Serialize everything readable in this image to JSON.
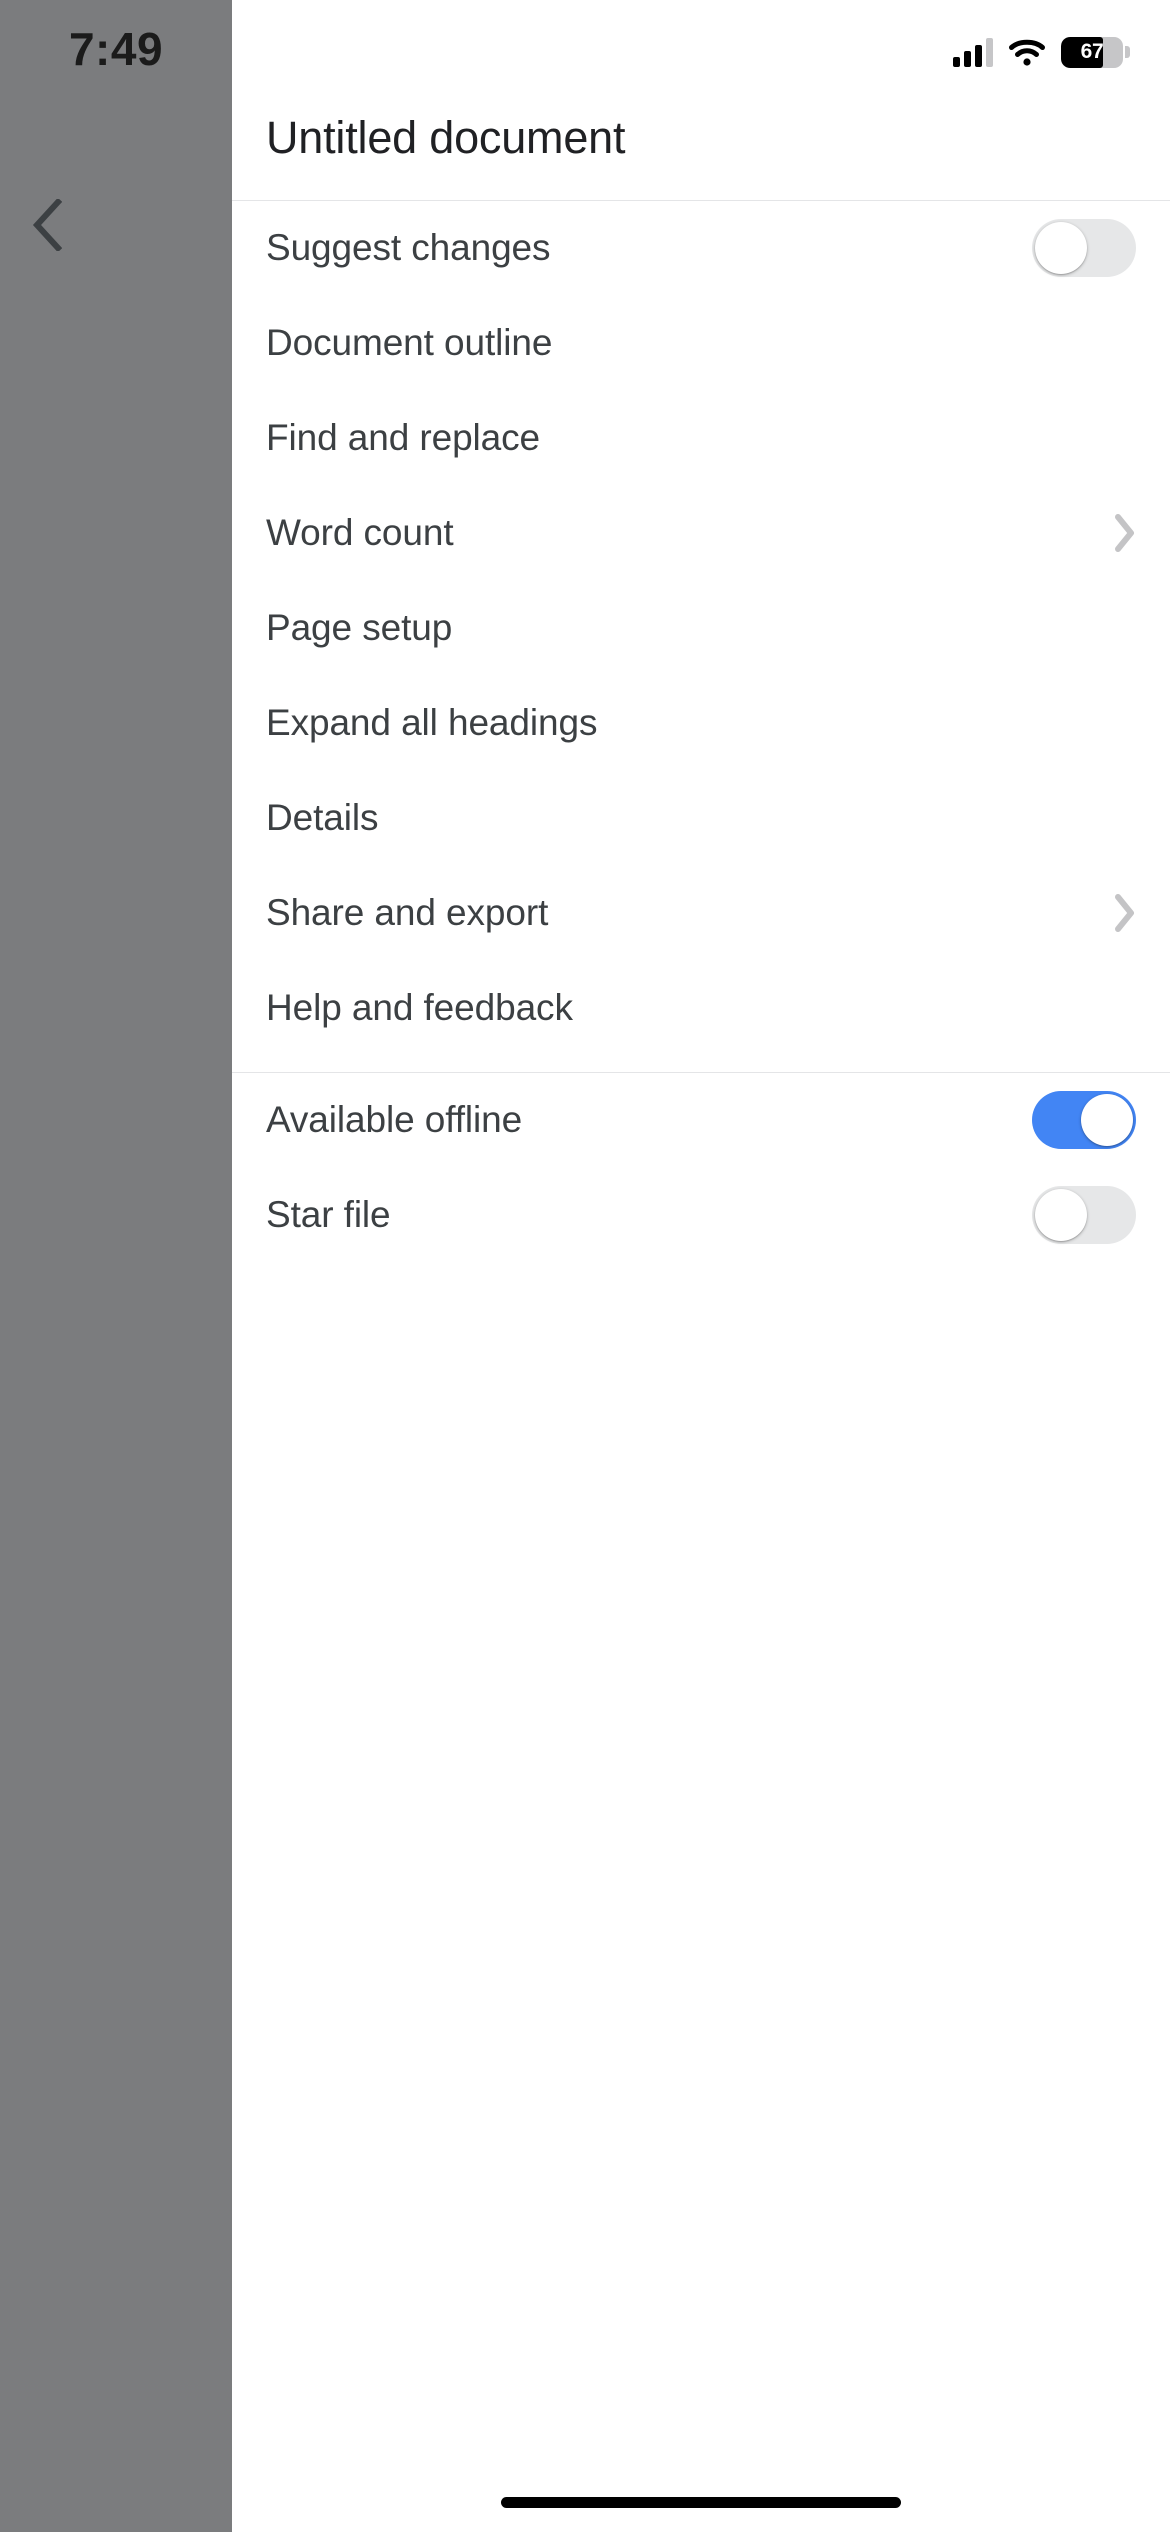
{
  "status_bar": {
    "time": "7:49",
    "cellular_icon": "cellular-bars-icon",
    "wifi_icon": "wifi-icon",
    "battery_icon": "battery-icon",
    "battery_percent": "67"
  },
  "navigation": {
    "back_icon": "chevron-left-icon"
  },
  "header": {
    "title": "Untitled document"
  },
  "menu": {
    "items": [
      {
        "label": "Suggest changes",
        "trailing": "toggle",
        "toggle_on": false,
        "name": "suggest-changes"
      },
      {
        "label": "Document outline",
        "trailing": "none",
        "toggle_on": null,
        "name": "document-outline"
      },
      {
        "label": "Find and replace",
        "trailing": "none",
        "toggle_on": null,
        "name": "find-and-replace"
      },
      {
        "label": "Word count",
        "trailing": "chevron",
        "toggle_on": null,
        "name": "word-count"
      },
      {
        "label": "Page setup",
        "trailing": "none",
        "toggle_on": null,
        "name": "page-setup"
      },
      {
        "label": "Expand all headings",
        "trailing": "none",
        "toggle_on": null,
        "name": "expand-all-headings"
      },
      {
        "label": "Details",
        "trailing": "none",
        "toggle_on": null,
        "name": "details"
      },
      {
        "label": "Share and export",
        "trailing": "chevron",
        "toggle_on": null,
        "name": "share-and-export"
      },
      {
        "label": "Help and feedback",
        "trailing": "none",
        "toggle_on": null,
        "name": "help-and-feedback"
      }
    ]
  },
  "offline_section": {
    "items": [
      {
        "label": "Available offline",
        "trailing": "toggle",
        "toggle_on": true,
        "name": "available-offline"
      },
      {
        "label": "Star file",
        "trailing": "toggle",
        "toggle_on": false,
        "name": "star-file"
      }
    ]
  },
  "colors": {
    "accent_on": "#4285F4",
    "toggle_off_track": "#E6E7E8",
    "scrim": "#7B7C7E",
    "text_primary": "#202124",
    "text_item": "#3C4043",
    "divider": "#E4E5E7",
    "chevron": "#C4C4C6"
  }
}
